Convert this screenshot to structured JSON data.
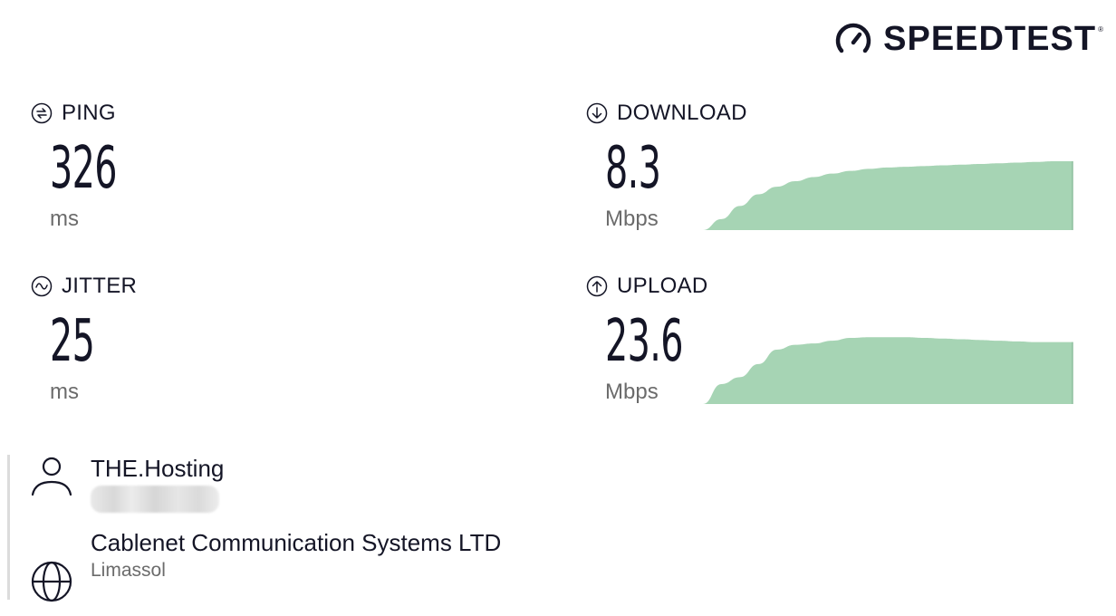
{
  "brand": {
    "name": "SPEEDTEST",
    "tm": "®",
    "icon": "speedometer-icon"
  },
  "metrics": {
    "ping": {
      "label": "PING",
      "value": "326",
      "unit": "ms",
      "icon": "ping-icon"
    },
    "jitter": {
      "label": "JITTER",
      "value": "25",
      "unit": "ms",
      "icon": "jitter-icon"
    },
    "download": {
      "label": "DOWNLOAD",
      "value": "8.3",
      "unit": "Mbps",
      "icon": "download-arrow-icon"
    },
    "upload": {
      "label": "UPLOAD",
      "value": "23.6",
      "unit": "Mbps",
      "icon": "upload-arrow-icon"
    }
  },
  "graph_color": "#a6d4b4",
  "graphs": {
    "download": [
      0.0,
      0.16,
      0.35,
      0.52,
      0.63,
      0.71,
      0.77,
      0.82,
      0.86,
      0.89,
      0.91,
      0.92,
      0.93,
      0.94,
      0.95,
      0.96,
      0.97,
      0.98,
      0.99,
      1.0,
      1.0
    ],
    "upload": [
      0.0,
      0.29,
      0.39,
      0.58,
      0.79,
      0.86,
      0.88,
      0.92,
      0.96,
      0.97,
      0.97,
      0.97,
      0.96,
      0.95,
      0.94,
      0.93,
      0.92,
      0.91,
      0.9,
      0.9,
      0.9
    ]
  },
  "server": {
    "host_name": "THE.Hosting",
    "host_icon": "user-icon",
    "isp_name": "Cablenet Communication Systems LTD",
    "isp_location": "Limassol",
    "isp_icon": "globe-icon"
  }
}
